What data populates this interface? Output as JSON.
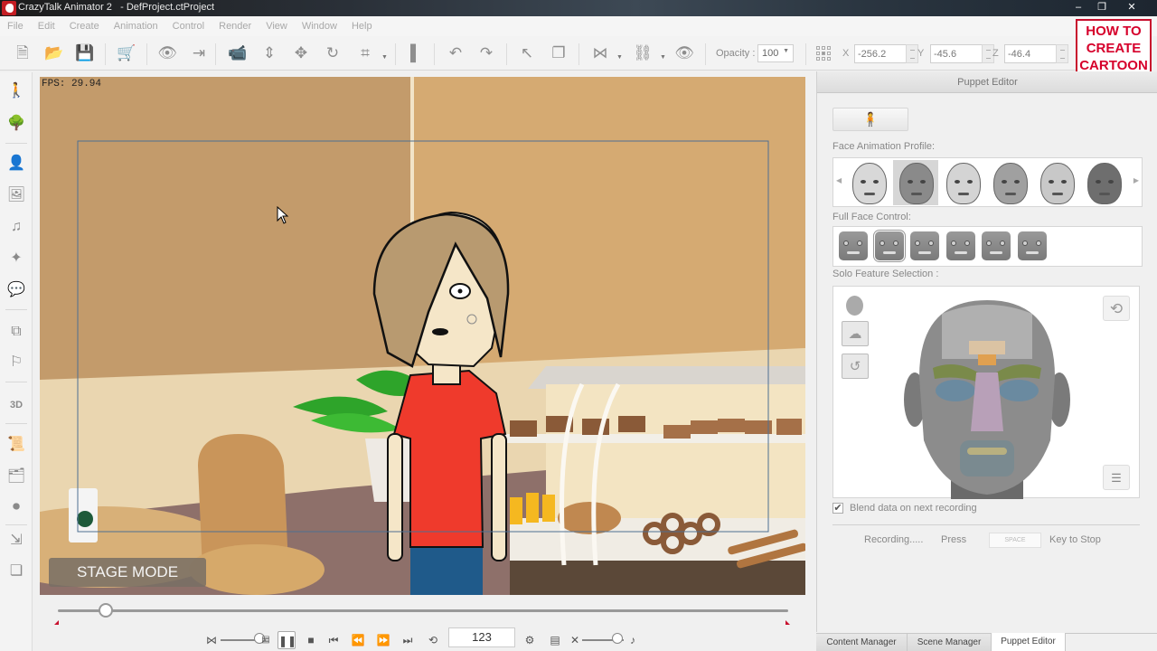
{
  "window": {
    "title": "CrazyTalk Animator 2   - DefProject.ctProject",
    "controls": {
      "minimize": "–",
      "maximize": "❐",
      "close": "✕"
    }
  },
  "menu": [
    "File",
    "Edit",
    "Create",
    "Animation",
    "Control",
    "Render",
    "View",
    "Window",
    "Help"
  ],
  "toolbar": {
    "icons": [
      {
        "name": "new-file-icon",
        "glyph": "🗎"
      },
      {
        "name": "open-folder-icon",
        "glyph": "📂"
      },
      {
        "name": "save-icon",
        "glyph": "💾"
      },
      {
        "name": "cart-icon",
        "glyph": "🛒"
      },
      {
        "name": "preview-icon",
        "glyph": "👁"
      },
      {
        "name": "export-icon",
        "glyph": "⇥"
      },
      {
        "name": "camera-icon",
        "glyph": "📹"
      },
      {
        "name": "move-vertical-icon",
        "glyph": "⇕"
      },
      {
        "name": "move-icon",
        "glyph": "✥"
      },
      {
        "name": "rotate-icon",
        "glyph": "↻"
      },
      {
        "name": "scale-icon",
        "glyph": "⌗"
      },
      {
        "name": "layer-order-icon",
        "glyph": "▌"
      },
      {
        "name": "undo-icon",
        "glyph": "↶"
      },
      {
        "name": "redo-icon",
        "glyph": "↷"
      },
      {
        "name": "select-icon",
        "glyph": "↖"
      },
      {
        "name": "duplicate-icon",
        "glyph": "❐"
      },
      {
        "name": "flip-icon",
        "glyph": "⋈"
      },
      {
        "name": "link-icon",
        "glyph": "⛓"
      },
      {
        "name": "visibility-icon",
        "glyph": "👁"
      }
    ],
    "opacity_label": "Opacity :",
    "opacity_value": "100",
    "x_label": "X",
    "x_value": "-256.2",
    "y_label": "Y",
    "y_value": "-45.6",
    "z_label": "Z",
    "z_value": "-46.4"
  },
  "logo": {
    "text": "HOW TO CREATE CARTOON MOVIE",
    "color": "#d6002b"
  },
  "left_tools": [
    {
      "name": "actor-icon",
      "glyph": "🚶"
    },
    {
      "name": "prop-icon",
      "glyph": "🌳"
    },
    {
      "name": "scene-icon",
      "glyph": "👤"
    },
    {
      "name": "background-icon",
      "glyph": "🖼"
    },
    {
      "name": "music-icon",
      "glyph": "♫"
    },
    {
      "name": "sound-fx-icon",
      "glyph": "✦"
    },
    {
      "name": "speech-bubble-icon",
      "glyph": "💬"
    },
    {
      "name": "media-icon",
      "glyph": "⧉"
    },
    {
      "name": "character-composer-icon",
      "glyph": "⚐"
    },
    {
      "name": "3d-motion-icon",
      "glyph": "3D"
    },
    {
      "name": "script-icon",
      "glyph": "📜"
    },
    {
      "name": "templates-icon",
      "glyph": "🗂"
    },
    {
      "name": "record-icon",
      "glyph": "⏺"
    },
    {
      "name": "pick-icon",
      "glyph": "⇲"
    },
    {
      "name": "layers-icon",
      "glyph": "❏"
    }
  ],
  "stage": {
    "fps": "FPS: 29.94",
    "mode_label": "STAGE MODE"
  },
  "timeline": {
    "progress": 0.066,
    "frame": "123",
    "speed_level": 0.85,
    "volume_level": 0.85
  },
  "puppet_editor": {
    "header": "Puppet Editor",
    "face_profile_label": "Face Animation Profile:",
    "face_profiles": [
      {
        "name": "girl",
        "skin": "#d8d8d8"
      },
      {
        "name": "boy",
        "skin": "#8a8a8a",
        "selected": true
      },
      {
        "name": "old-woman",
        "skin": "#d4d4d4"
      },
      {
        "name": "woman",
        "skin": "#a0a0a0"
      },
      {
        "name": "fat-man",
        "skin": "#c8c8c8"
      },
      {
        "name": "bald-man",
        "skin": "#6e6e6e"
      }
    ],
    "full_face_label": "Full Face Control:",
    "full_face_expressions": [
      "neutral",
      "smile",
      "calm",
      "sad",
      "happy",
      "surprised"
    ],
    "solo_label": "Solo Feature Selection :",
    "blend_label": "Blend data on next  recording",
    "blend_checked": true,
    "recording_label": "Recording.....",
    "press_label": "Press",
    "space_key": "SPACE",
    "stop_label": "Key to Stop"
  },
  "tabs": [
    {
      "label": "Content Manager",
      "active": false
    },
    {
      "label": "Scene Manager",
      "active": false
    },
    {
      "label": "Puppet Editor",
      "active": true
    }
  ]
}
